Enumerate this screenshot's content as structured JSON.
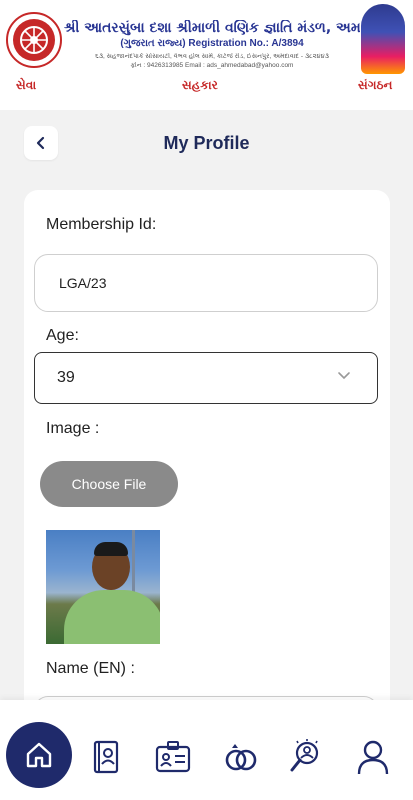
{
  "header": {
    "org_title": "શ્રી આતરસુંબા દશા શ્રીમાળી વણિક જ્ઞાતિ મંડળ, અમદાવાદ",
    "registration": "(ગુજરાત રાજ્ય) Registration No.: A/3894",
    "address": "૬૩, સહજાનંદપાર્ક સોસાયટી, વૈભવ હોલ સામે, કાટેજે રોડ, ઈસનપુર, અમદાવાદ - ૩૮૨૪૪૩",
    "contact": "ફોન : 9426313985 Email : ads_ahmedabad@yahoo.com",
    "motto": [
      "સેવા",
      "સહકાર",
      "સંગઠન"
    ],
    "brand_color": "#283593",
    "accent_color": "#c62828"
  },
  "page": {
    "title": "My Profile",
    "back_icon": "chevron-left-icon"
  },
  "form": {
    "membership_label": "Membership Id:",
    "membership_value": "LGA/23",
    "age_label": "Age:",
    "age_value": "39",
    "image_label": "Image :",
    "choose_file_label": "Choose File",
    "name_en_label": "Name (EN) :"
  },
  "nav": {
    "items": [
      "home-icon",
      "directory-book-icon",
      "id-card-icon",
      "rings-icon",
      "search-profile-icon",
      "user-icon"
    ],
    "active_color": "#1f2a6b"
  }
}
